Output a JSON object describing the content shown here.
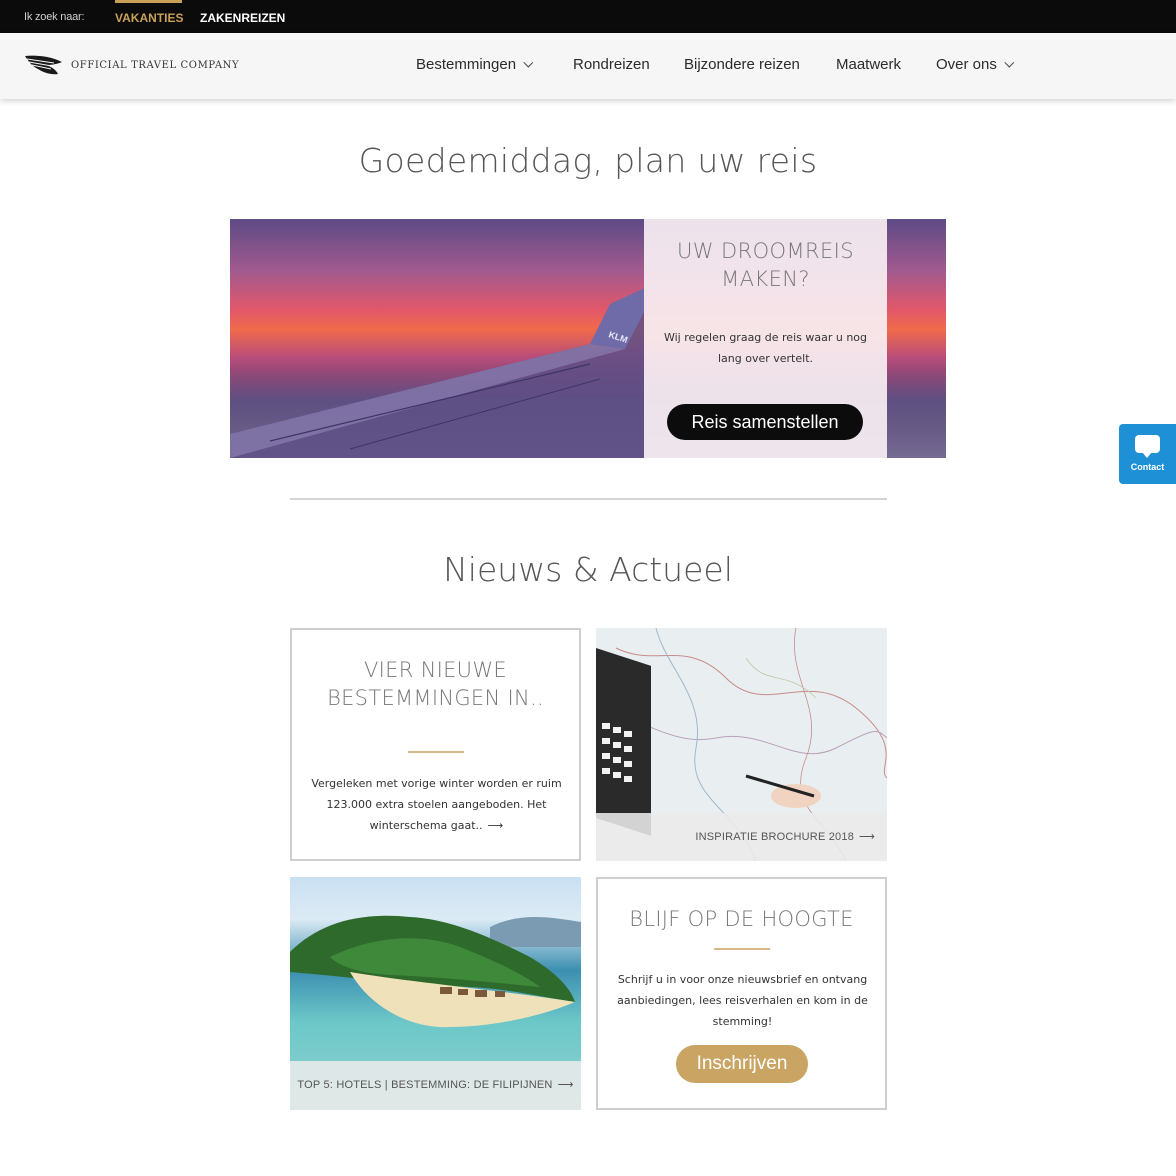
{
  "topbar": {
    "lead_text": "Ik zoek naar:",
    "tabs": [
      {
        "label": "VAKANTIES",
        "active": true
      },
      {
        "label": "ZAKENREIZEN",
        "active": false
      }
    ]
  },
  "header": {
    "logo_text": "OFFICIAL TRAVEL COMPANY",
    "nav": [
      {
        "label": "Bestemmingen",
        "dropdown": true
      },
      {
        "label": "Rondreizen",
        "dropdown": false
      },
      {
        "label": "Bijzondere reizen",
        "dropdown": false
      },
      {
        "label": "Maatwerk",
        "dropdown": false
      },
      {
        "label": "Over ons",
        "dropdown": true
      }
    ]
  },
  "main": {
    "greeting": "Goedemiddag, plan uw reis",
    "hero": {
      "title": "UW DROOMREIS MAKEN?",
      "text": "Wij regelen graag de reis waar u nog lang over vertelt.",
      "button_label": "Reis samenstellen",
      "image_logo": "KLM"
    },
    "news_title": "Nieuws & Actueel",
    "cards": [
      {
        "title": "VIER NIEUWE BESTEMMINGEN IN..",
        "text": "Vergeleken met vorige winter worden er ruim 123.000 extra stoelen aangeboden. Het winterschema gaat.."
      },
      {
        "caption": "INSPIRATIE BROCHURE 2018"
      },
      {
        "caption": "TOP 5: HOTELS | BESTEMMING: DE FILIPIJNEN"
      },
      {
        "title": "BLIJF OP DE HOOGTE",
        "text": "Schrijf u in voor onze nieuwsbrief en ontvang aanbiedingen, lees reisverhalen en kom in de stemming!",
        "button_label": "Inschrijven"
      }
    ]
  },
  "contact_widget": {
    "label": "Contact"
  },
  "colors": {
    "accent_gold": "#c9a462",
    "topbar_bg": "#0b0b0b",
    "contact_blue": "#1e90d6"
  },
  "icons": [
    "logo-wing-icon",
    "chevron-down-icon",
    "arrow-right-icon",
    "chat-bubble-icon"
  ]
}
